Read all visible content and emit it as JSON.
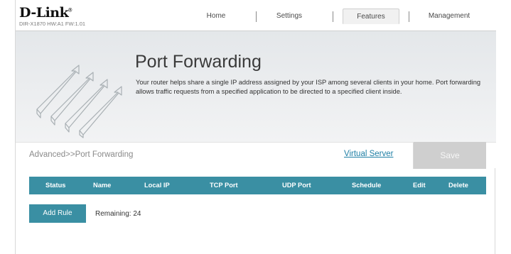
{
  "header": {
    "logo": "D-Link",
    "model": "DIR-X1870 HW:A1 FW:1.01",
    "nav": {
      "home": "Home",
      "settings": "Settings",
      "features": "Features",
      "management": "Management"
    }
  },
  "banner": {
    "title": "Port Forwarding",
    "description": "Your router helps share a single IP address assigned by your ISP among several clients in your home. Port forwarding allows traffic requests from a specified application to be directed to a specified client inside."
  },
  "toolbar": {
    "breadcrumb": "Advanced>>Port Forwarding",
    "virtual_server_link": "Virtual Server",
    "save_label": "Save"
  },
  "table": {
    "columns": [
      "Status",
      "Name",
      "Local IP",
      "TCP Port",
      "UDP Port",
      "Schedule",
      "Edit",
      "Delete"
    ],
    "rows": []
  },
  "rules": {
    "add_rule_label": "Add Rule",
    "remaining_text": "Remaining: 24"
  },
  "colors": {
    "accent": "#3a8fa3",
    "link": "#1f7fa5",
    "disabled_button": "#cfcfcf"
  }
}
